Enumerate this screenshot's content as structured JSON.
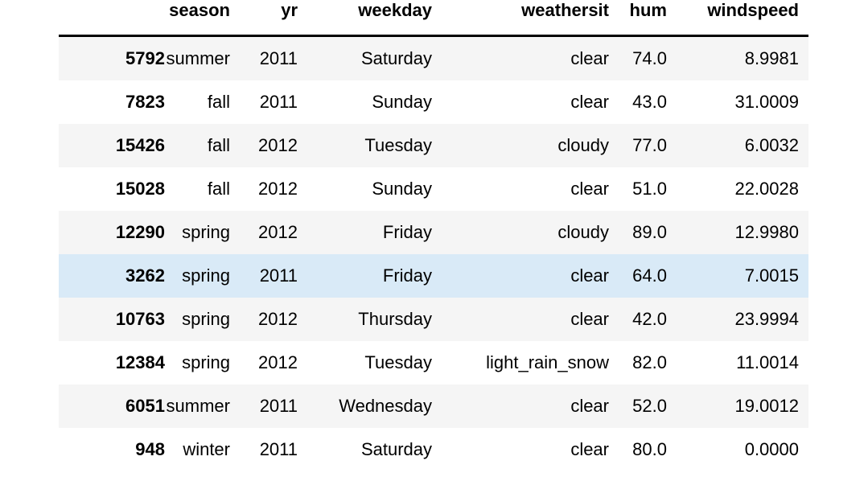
{
  "table": {
    "index_header": "",
    "columns": [
      "season",
      "yr",
      "weekday",
      "weathersit",
      "hum",
      "windspeed"
    ],
    "rows": [
      {
        "index": "5792",
        "season": "summer",
        "yr": "2011",
        "weekday": "Saturday",
        "weathersit": "clear",
        "hum": "74.0",
        "windspeed": "8.9981",
        "style": "stripe"
      },
      {
        "index": "7823",
        "season": "fall",
        "yr": "2011",
        "weekday": "Sunday",
        "weathersit": "clear",
        "hum": "43.0",
        "windspeed": "31.0009",
        "style": "plain"
      },
      {
        "index": "15426",
        "season": "fall",
        "yr": "2012",
        "weekday": "Tuesday",
        "weathersit": "cloudy",
        "hum": "77.0",
        "windspeed": "6.0032",
        "style": "stripe"
      },
      {
        "index": "15028",
        "season": "fall",
        "yr": "2012",
        "weekday": "Sunday",
        "weathersit": "clear",
        "hum": "51.0",
        "windspeed": "22.0028",
        "style": "plain"
      },
      {
        "index": "12290",
        "season": "spring",
        "yr": "2012",
        "weekday": "Friday",
        "weathersit": "cloudy",
        "hum": "89.0",
        "windspeed": "12.9980",
        "style": "stripe"
      },
      {
        "index": "3262",
        "season": "spring",
        "yr": "2011",
        "weekday": "Friday",
        "weathersit": "clear",
        "hum": "64.0",
        "windspeed": "7.0015",
        "style": "highlight"
      },
      {
        "index": "10763",
        "season": "spring",
        "yr": "2012",
        "weekday": "Thursday",
        "weathersit": "clear",
        "hum": "42.0",
        "windspeed": "23.9994",
        "style": "stripe"
      },
      {
        "index": "12384",
        "season": "spring",
        "yr": "2012",
        "weekday": "Tuesday",
        "weathersit": "light_rain_snow",
        "hum": "82.0",
        "windspeed": "11.0014",
        "style": "plain"
      },
      {
        "index": "6051",
        "season": "summer",
        "yr": "2011",
        "weekday": "Wednesday",
        "weathersit": "clear",
        "hum": "52.0",
        "windspeed": "19.0012",
        "style": "stripe"
      },
      {
        "index": "948",
        "season": "winter",
        "yr": "2011",
        "weekday": "Saturday",
        "weathersit": "clear",
        "hum": "80.0",
        "windspeed": "0.0000",
        "style": "plain"
      }
    ]
  },
  "colors": {
    "background": "#ffffff",
    "text": "#000000",
    "stripe": "#f5f5f5",
    "highlight": "#d9eaf7",
    "header_rule": "#000000"
  }
}
